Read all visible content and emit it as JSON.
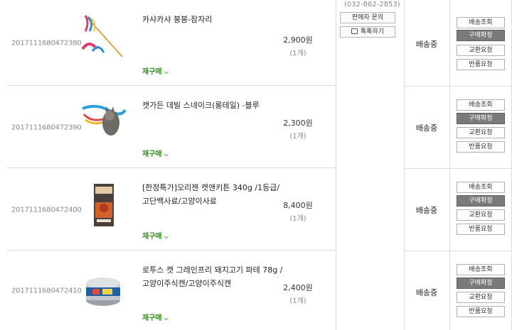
{
  "seller": {
    "phone": "(032-862-2853)",
    "contact_label": "판매자 문의",
    "talk_label": "톡톡하기"
  },
  "orders": [
    {
      "order_no": "2017111680472380",
      "title": "카샤카샤 붕붕-잠자리",
      "price": "2,900원",
      "qty": "(1개)",
      "reorder": "재구매",
      "status": "배송중",
      "thumb": "feather-wand-toy"
    },
    {
      "order_no": "2017111680472390",
      "title": "캣가든 데빌 스네이크(롱테일) -블루",
      "price": "2,300원",
      "qty": "(1개)",
      "reorder": "재구매",
      "status": "배송중",
      "thumb": "snake-toy-with-cat"
    },
    {
      "order_no": "2017111680472400",
      "title": "[한정특가]오리젠 캣앤키튼 340g /1등급/고단백사료/고양이사료",
      "price": "8,400원",
      "qty": "(1개)",
      "reorder": "재구매",
      "status": "배송중",
      "thumb": "cat-food-bag"
    },
    {
      "order_no": "2017111680472410",
      "title": "로투스 캣 그레인프리 돼지고기 파테 78g /고양이주식캔/고양이주식캔",
      "price": "2,400원",
      "qty": "(1개)",
      "reorder": "재구매",
      "status": "배송중",
      "thumb": "cat-food-can"
    }
  ],
  "actions": {
    "track": "배송조회",
    "confirm": "구매확정",
    "exchange": "교환요청",
    "return": "반품요청"
  }
}
